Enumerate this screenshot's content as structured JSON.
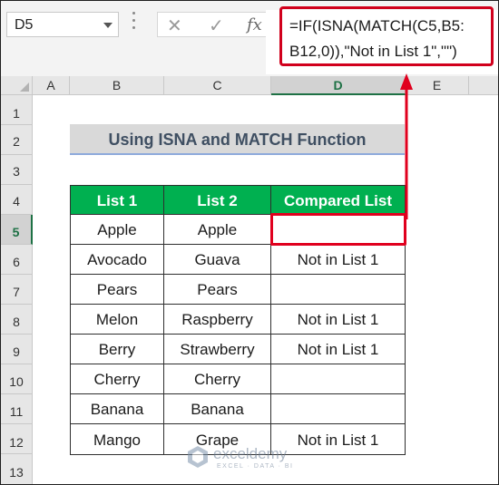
{
  "formula_bar": {
    "name_box": "D5",
    "cancel_icon": "x-icon",
    "enter_icon": "check-icon",
    "function_icon": "fx",
    "formula_line1": "=IF(ISNA(MATCH(C5,B5:",
    "formula_line2": "B12,0)),\"Not in List 1\",\"\")"
  },
  "columns": [
    "A",
    "B",
    "C",
    "D",
    "E"
  ],
  "selected_column": "D",
  "rows": [
    "1",
    "2",
    "3",
    "4",
    "5",
    "6",
    "7",
    "8",
    "9",
    "10",
    "11",
    "12",
    "13"
  ],
  "selected_row": "5",
  "title": "Using ISNA and MATCH Function",
  "table": {
    "headers": [
      "List 1",
      "List 2",
      "Compared List"
    ],
    "rows": [
      [
        "Apple",
        "Apple",
        ""
      ],
      [
        "Avocado",
        "Guava",
        "Not in List 1"
      ],
      [
        "Pears",
        "Pears",
        ""
      ],
      [
        "Melon",
        "Raspberry",
        "Not in List 1"
      ],
      [
        "Berry",
        "Strawberry",
        "Not in List 1"
      ],
      [
        "Cherry",
        "Cherry",
        ""
      ],
      [
        "Banana",
        "Banana",
        ""
      ],
      [
        "Mango",
        "Grape",
        "Not in List 1"
      ]
    ]
  },
  "watermark": {
    "name": "exceldemy",
    "tagline": "EXCEL · DATA · BI"
  },
  "colors": {
    "header_green": "#00b050",
    "highlight_red": "#d1001c",
    "title_underline": "#8eaadb"
  }
}
